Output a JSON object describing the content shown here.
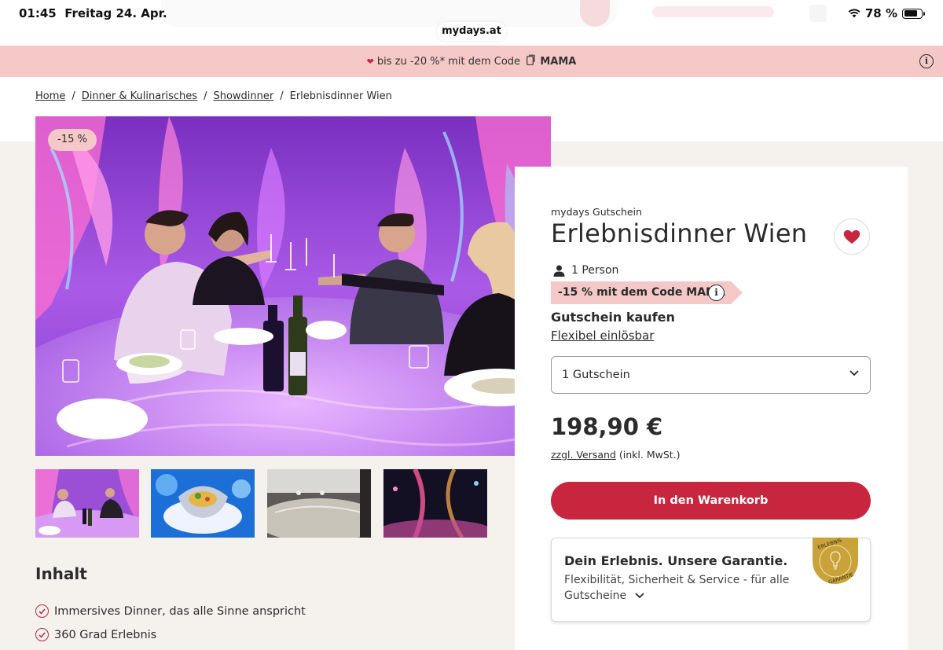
{
  "status_bar": {
    "time": "01:45",
    "date": "Freitag 24. Apr.",
    "battery": "78 %",
    "battery_level": 0.78,
    "url": "mydays.at"
  },
  "promo": {
    "text": "bis zu -20 %* mit dem Code",
    "code": "MAMA"
  },
  "breadcrumb": {
    "items": [
      "Home",
      "Dinner & Kulinarisches",
      "Showdinner"
    ],
    "current": "Erlebnisdinner Wien",
    "separator": "/"
  },
  "gallery": {
    "discount_badge": "-15 %",
    "thumbnail_count": 4
  },
  "product": {
    "brand": "mydays Gutschein",
    "title": "Erlebnisdinner Wien",
    "persons": "1 Person",
    "code_offer": "-15 % mit dem Code MAMA",
    "buy_heading": "Gutschein kaufen",
    "flex_link": "Flexibel einlösbar",
    "quantity_selected": "1 Gutschein",
    "price": "198,90 €",
    "shipping_link": "zzgl. Versand",
    "shipping_note": "(inkl. MwSt.)",
    "cart_button": "In den Warenkorb"
  },
  "guarantee": {
    "title": "Dein Erlebnis. Unsere Garantie.",
    "text": "Flexibilität, Sicherheit & Service - für alle Gutscheine",
    "seal_text": "ERLEBNIS GARANTIE"
  },
  "content": {
    "title": "Inhalt",
    "features": [
      "Immersives Dinner, das alle Sinne anspricht",
      "360 Grad Erlebnis"
    ]
  },
  "colors": {
    "accent": "#c8253f",
    "promo_bg": "#f5c8c8",
    "seal_gold": "#c9a23a"
  }
}
